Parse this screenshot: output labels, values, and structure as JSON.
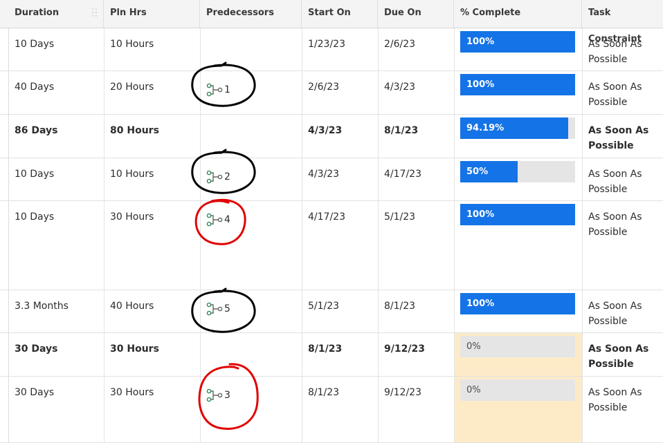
{
  "columns": [
    {
      "key": "duration",
      "label": "Duration"
    },
    {
      "key": "pln_hrs",
      "label": "Pln Hrs"
    },
    {
      "key": "predecessors",
      "label": "Predecessors"
    },
    {
      "key": "start_on",
      "label": "Start On"
    },
    {
      "key": "due_on",
      "label": "Due On"
    },
    {
      "key": "pct_complete",
      "label": "% Complete"
    },
    {
      "key": "constraint",
      "label": "Task Constraint"
    }
  ],
  "rows": [
    {
      "duration": "10 Days",
      "pln_hrs": "10 Hours",
      "predecessor": "",
      "start_on": "1/23/23",
      "due_on": "2/6/23",
      "pct_label": "100%",
      "pct_value": 100,
      "constraint": "As Soon As Possible",
      "bold": false,
      "highlight": false
    },
    {
      "duration": "40 Days",
      "pln_hrs": "20 Hours",
      "predecessor": "1",
      "start_on": "2/6/23",
      "due_on": "4/3/23",
      "pct_label": "100%",
      "pct_value": 100,
      "constraint": "As Soon As Possible",
      "bold": false,
      "highlight": false,
      "circle": "black"
    },
    {
      "duration": "86 Days",
      "pln_hrs": "80 Hours",
      "predecessor": "",
      "start_on": "4/3/23",
      "due_on": "8/1/23",
      "pct_label": "94.19%",
      "pct_value": 94.19,
      "constraint": "As Soon As Possible",
      "bold": true,
      "highlight": false
    },
    {
      "duration": "10 Days",
      "pln_hrs": "10 Hours",
      "predecessor": "2",
      "start_on": "4/3/23",
      "due_on": "4/17/23",
      "pct_label": "50%",
      "pct_value": 50,
      "constraint": "As Soon As Possible",
      "bold": false,
      "highlight": false,
      "circle": "black"
    },
    {
      "duration": "10 Days",
      "pln_hrs": "30 Hours",
      "predecessor": "4",
      "start_on": "4/17/23",
      "due_on": "5/1/23",
      "pct_label": "100%",
      "pct_value": 100,
      "constraint": "As Soon As Possible",
      "bold": false,
      "highlight": false,
      "circle": "red"
    },
    {
      "duration": "3.3 Months",
      "pln_hrs": "40 Hours",
      "predecessor": "5",
      "start_on": "5/1/23",
      "due_on": "8/1/23",
      "pct_label": "100%",
      "pct_value": 100,
      "constraint": "As Soon As Possible",
      "bold": false,
      "highlight": false,
      "circle": "black"
    },
    {
      "duration": "30 Days",
      "pln_hrs": "30 Hours",
      "predecessor": "",
      "start_on": "8/1/23",
      "due_on": "9/12/23",
      "pct_label": "0%",
      "pct_value": 0,
      "constraint": "As Soon As Possible",
      "bold": true,
      "highlight": true
    },
    {
      "duration": "30 Days",
      "pln_hrs": "30 Hours",
      "predecessor": "3",
      "start_on": "8/1/23",
      "due_on": "9/12/23",
      "pct_label": "0%",
      "pct_value": 0,
      "constraint": "As Soon As Possible",
      "bold": false,
      "highlight": true,
      "circle": "red"
    }
  ],
  "colors": {
    "progress": "#1473e6",
    "track": "#e5e5e5",
    "highlight": "#fdebc8",
    "link_icon": "#2e8b57",
    "circle_black": "#000000",
    "circle_red": "#e00000"
  },
  "icons": {
    "predecessor": "predecessor-link-icon",
    "grip": "column-grip-icon"
  }
}
